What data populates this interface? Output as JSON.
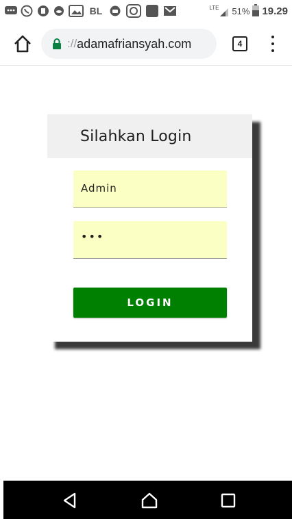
{
  "status_bar": {
    "icons": [
      "message-icon",
      "whatsapp-icon",
      "app-icon",
      "cloud-icon",
      "gallery-icon",
      "bl-icon",
      "camera-icon",
      "face-icon",
      "square-icon",
      "gmail-icon",
      "lte-signal-icon",
      "battery-icon"
    ],
    "bl_label": "BL",
    "network_label": "LTE",
    "battery": "51%",
    "time": "19.29"
  },
  "browser": {
    "url_prefix": "://",
    "url": "adamafriansyah.com",
    "tab_count": "4",
    "home_icon": "home-icon",
    "lock_icon": "lock-icon",
    "menu_icon": "more-vert-icon"
  },
  "login": {
    "title": "Silahkan Login",
    "username_value": "Admin",
    "password_value": "•••",
    "button_label": "LOGIN",
    "colors": {
      "field_bg": "#fbffc4",
      "button_bg": "#008000",
      "header_bg": "#f0f0f0"
    }
  },
  "nav_bar": {
    "icons": [
      "back-icon",
      "home-nav-icon",
      "recents-icon"
    ]
  }
}
